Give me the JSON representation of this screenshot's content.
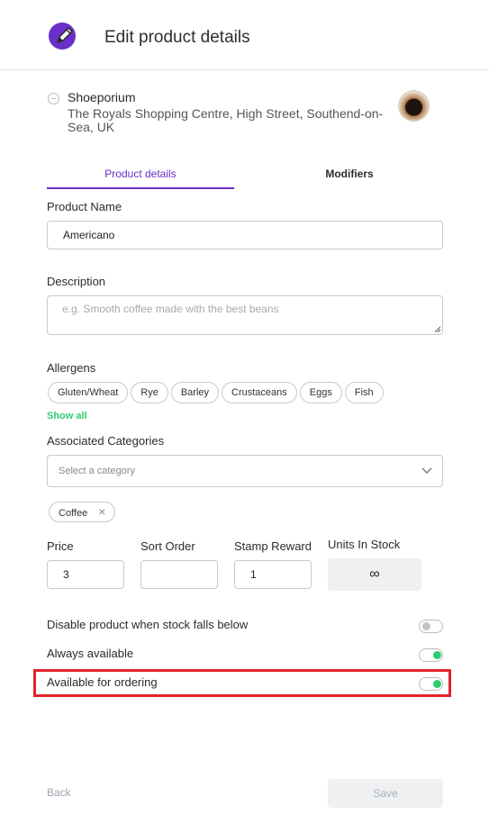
{
  "header": {
    "title": "Edit product details",
    "icon": "pencil-icon",
    "icon_color": "#6a2fc8"
  },
  "store": {
    "name": "Shoeporium",
    "address": "The Royals Shopping Centre, High Street, Southend-on-Sea, UK"
  },
  "tabs": [
    {
      "label": "Product details",
      "active": true
    },
    {
      "label": "Modifiers",
      "active": false
    }
  ],
  "form": {
    "product_name_label": "Product Name",
    "product_name_value": "Americano",
    "description_label": "Description",
    "description_placeholder": "e.g. Smooth coffee made with the best beans",
    "allergens_label": "Allergens",
    "allergens": [
      "Gluten/Wheat",
      "Rye",
      "Barley",
      "Crustaceans",
      "Eggs",
      "Fish"
    ],
    "show_all": "Show all",
    "categories_label": "Associated Categories",
    "categories_placeholder": "Select a category",
    "selected_categories": [
      "Coffee"
    ],
    "price_label": "Price",
    "price_value": "3",
    "sort_order_label": "Sort Order",
    "sort_order_value": "",
    "stamp_reward_label": "Stamp Reward",
    "stamp_reward_value": "1",
    "units_label": "Units In Stock",
    "units_value": "∞"
  },
  "toggles": [
    {
      "label": "Disable product when stock falls below",
      "on": false
    },
    {
      "label": "Always available",
      "on": true
    },
    {
      "label": "Available for ordering",
      "on": true
    }
  ],
  "footer": {
    "back": "Back",
    "save": "Save"
  },
  "colors": {
    "accent": "#6a2fc8",
    "toggle_on": "#2ecc71",
    "highlight": "#e2222a"
  }
}
